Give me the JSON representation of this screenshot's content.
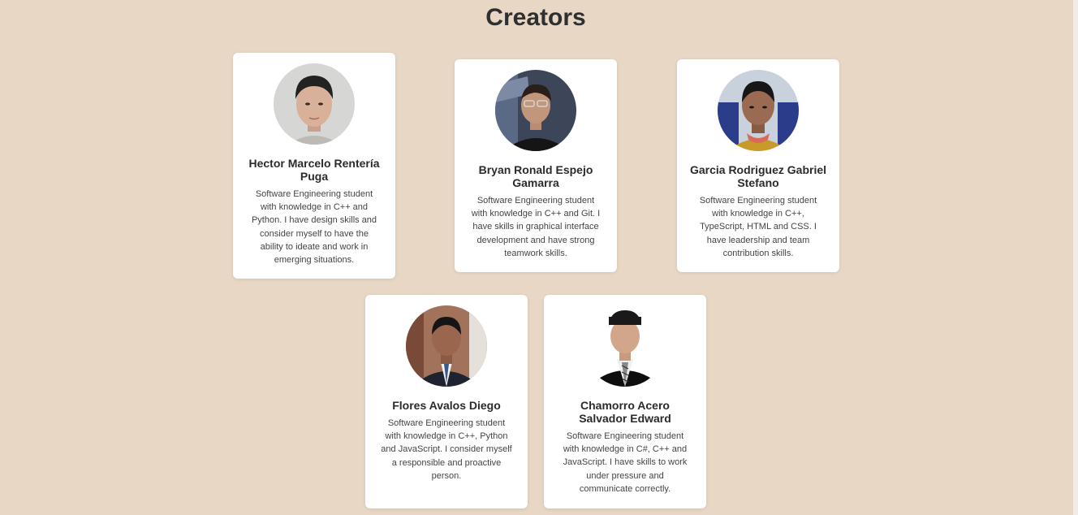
{
  "page": {
    "title": "Creators"
  },
  "creators": [
    {
      "name": "Hector Marcelo Rentería Puga",
      "description": "Software Engineering student with knowledge in C++ and Python. I have design skills and consider myself to have the ability to ideate and work in emerging situations.",
      "avatar_icon": "person-photo-icon"
    },
    {
      "name": "Bryan Ronald Espejo Gamarra",
      "description": "Software Engineering student with knowledge in C++ and Git. I have skills in graphical interface development and have strong teamwork skills.",
      "avatar_icon": "person-photo-icon"
    },
    {
      "name": "Garcia Rodriguez Gabriel Stefano",
      "description": "Software Engineering student with knowledge in C++, TypeScript, HTML and CSS. I have leadership and team contribution skills.",
      "avatar_icon": "person-photo-icon"
    },
    {
      "name": "Flores Avalos Diego",
      "description": "Software Engineering student with knowledge in C++, Python and JavaScript. I consider myself a responsible and proactive person.",
      "avatar_icon": "person-photo-icon"
    },
    {
      "name": "Chamorro Acero Salvador Edward",
      "description": "Software Engineering student with knowledge in C#, C++ and JavaScript. I have skills to work under pressure and communicate correctly.",
      "avatar_icon": "person-photo-icon"
    }
  ],
  "colors": {
    "background": "#e8d7c5",
    "card": "#ffffff",
    "title": "#2f2f2f"
  }
}
